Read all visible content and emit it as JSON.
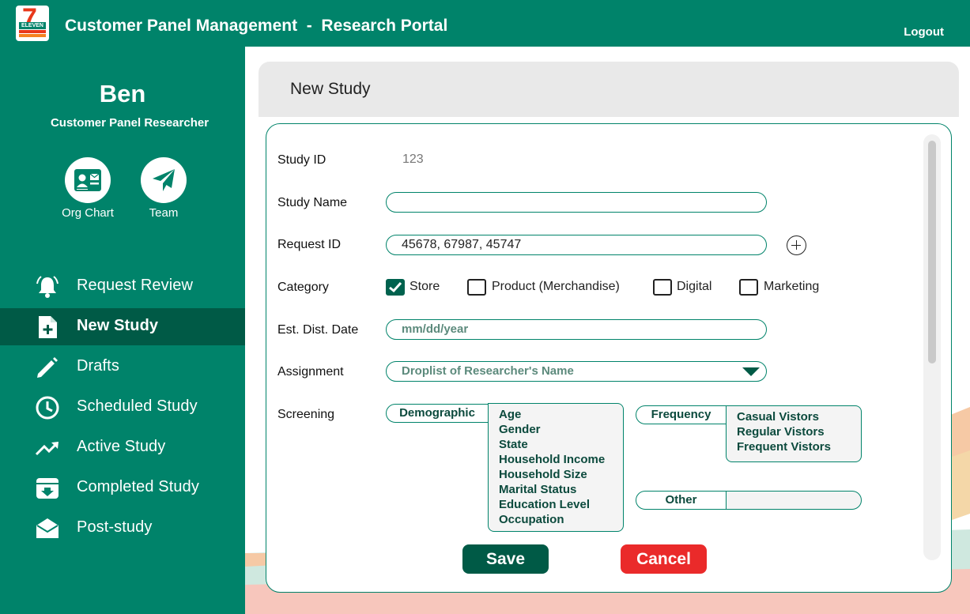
{
  "app": {
    "title": "Customer Panel Management  -  Research Portal",
    "logo_text": "ELEVEN",
    "logo_numeral": "7",
    "logout_label": "Logout"
  },
  "user": {
    "name": "Ben",
    "role": "Customer Panel Researcher"
  },
  "shortcuts": [
    {
      "label": "Org Chart",
      "icon": "contact-card-icon"
    },
    {
      "label": "Team",
      "icon": "paper-plane-icon"
    }
  ],
  "nav": {
    "items": [
      {
        "label": "Request Review",
        "icon": "bell-icon"
      },
      {
        "label": "New Study",
        "icon": "file-plus-icon",
        "active": true
      },
      {
        "label": "Drafts",
        "icon": "pencil-icon"
      },
      {
        "label": "Scheduled Study",
        "icon": "clock-icon"
      },
      {
        "label": "Active Study",
        "icon": "trending-up-icon"
      },
      {
        "label": "Completed Study",
        "icon": "archive-icon"
      },
      {
        "label": "Post-study",
        "icon": "open-envelope-icon"
      }
    ]
  },
  "page": {
    "title": "New Study"
  },
  "form": {
    "study_id": {
      "label": "Study ID",
      "value": "123"
    },
    "study_name": {
      "label": "Study Name",
      "value": ""
    },
    "request_id": {
      "label": "Request ID",
      "value": "45678, 67987, 45747"
    },
    "category": {
      "label": "Category",
      "options": [
        {
          "label": "Store",
          "checked": true
        },
        {
          "label": "Product (Merchandise)",
          "checked": false
        },
        {
          "label": "Digital",
          "checked": false
        },
        {
          "label": "Marketing",
          "checked": false
        }
      ]
    },
    "dist_date": {
      "label": "Est. Dist. Date",
      "placeholder": "mm/dd/year"
    },
    "assignment": {
      "label": "Assignment",
      "placeholder": "Droplist of Researcher's Name"
    },
    "screening": {
      "label": "Screening",
      "demographic": {
        "label": "Demographic",
        "options": [
          "Age",
          "Gender",
          "State",
          "Household Income",
          "Household Size",
          "Marital Status",
          "Education Level",
          "Occupation"
        ]
      },
      "frequency": {
        "label": "Frequency",
        "options": [
          "Casual Vistors",
          "Regular Vistors",
          "Frequent Vistors"
        ]
      },
      "other": {
        "label": "Other",
        "value": ""
      }
    },
    "save_label": "Save",
    "cancel_label": "Cancel"
  },
  "colors": {
    "brand_green": "#00836a",
    "active_nav": "#005a46",
    "cancel_red": "#ea2a2a",
    "checkbox_green": "#00624e"
  }
}
